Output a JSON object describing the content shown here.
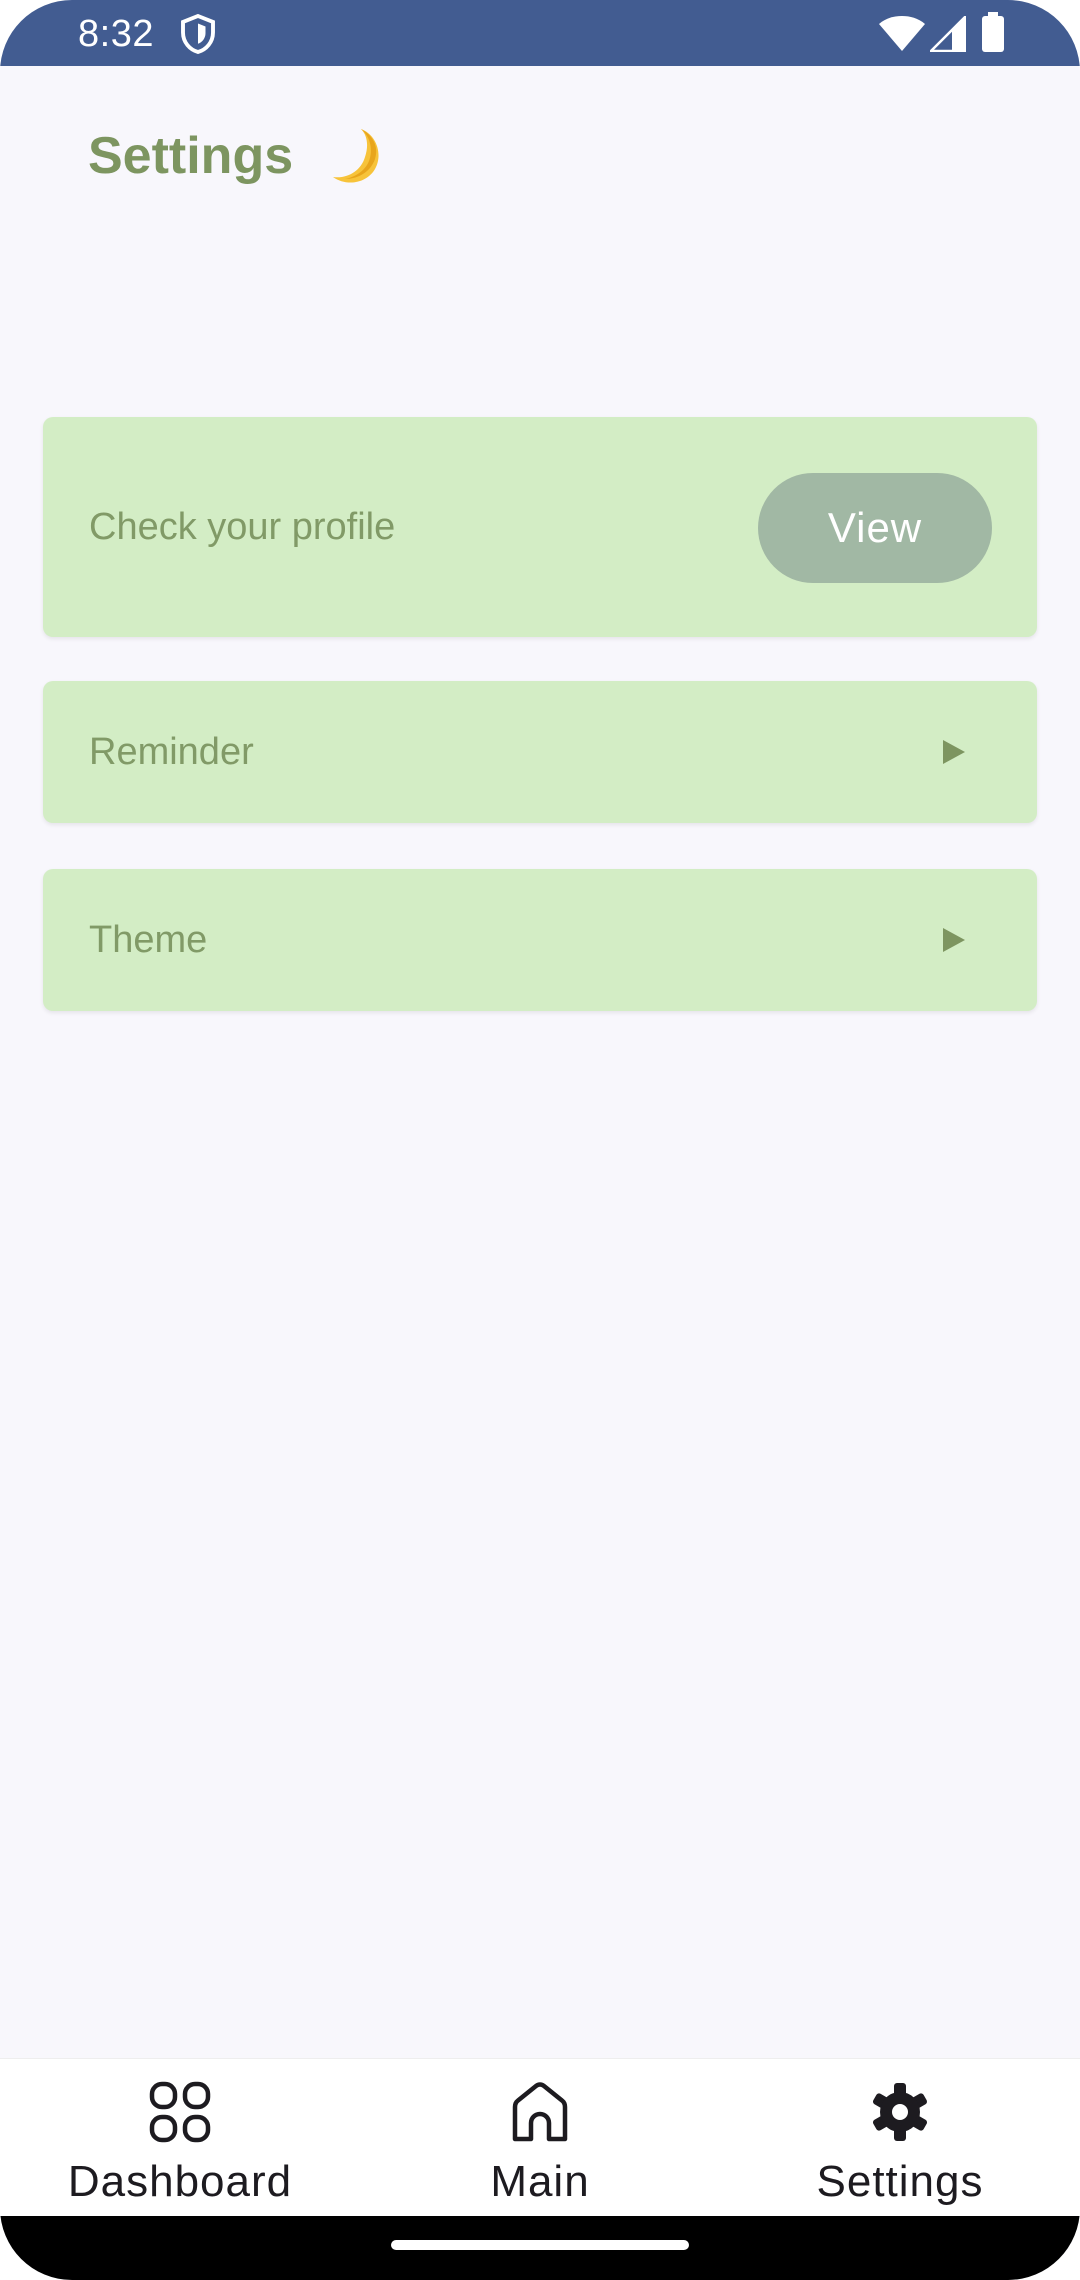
{
  "status_bar": {
    "time": "8:32",
    "icons": [
      "shield-icon",
      "wifi-icon",
      "signal-icon",
      "battery-icon"
    ],
    "background": "#425c91"
  },
  "header": {
    "title": "Settings",
    "theme_icon": "moon-icon"
  },
  "cards": {
    "profile": {
      "label": "Check your profile",
      "button_label": "View"
    },
    "reminder": {
      "label": "Reminder",
      "icon": "play-arrow-icon"
    },
    "theme": {
      "label": "Theme",
      "icon": "play-arrow-icon"
    }
  },
  "bottom_nav": {
    "items": [
      {
        "label": "Dashboard",
        "icon": "grid-icon"
      },
      {
        "label": "Main",
        "icon": "home-icon"
      },
      {
        "label": "Settings",
        "icon": "gear-icon",
        "selected": true
      }
    ]
  },
  "colors": {
    "accent_text": "#7d9560",
    "card_background": "#d3edc5",
    "button_background": "#a1b8a4",
    "page_background": "#f8f7fc"
  }
}
